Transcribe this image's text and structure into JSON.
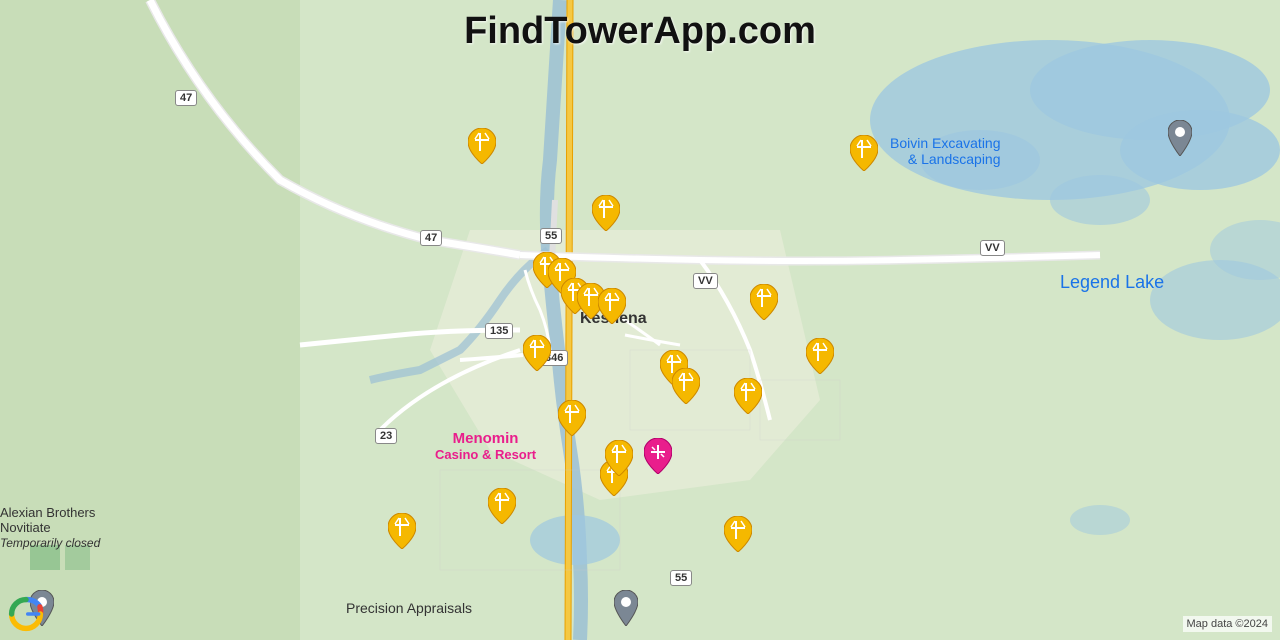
{
  "page": {
    "title": "FindTowerApp.com",
    "google_attribution": "Google",
    "map_attribution": "Map data ©2024"
  },
  "labels": {
    "legend_lake": "Legend Lake",
    "keshena": "Keshena",
    "boivin": "Boivin Excavating\n& Landscaping",
    "menomin_casino": "Menomin\nCasino & Resort",
    "alexian": "Alexian Brothers\nNovitiate\nTemporarily closed",
    "precision": "Precision Appraisals"
  },
  "roads": {
    "r47a": "47",
    "r47b": "47",
    "r55a": "55",
    "r55b": "55",
    "r135": "135",
    "r346": "346",
    "r23": "23",
    "vva": "VV",
    "vvb": "VV"
  },
  "colors": {
    "map_green": "#c8dbc8",
    "water_blue": "#a8c8e8",
    "road_yellow": "#f5c842",
    "road_white": "#ffffff",
    "tower_pin": "#f5b800",
    "gray_pin": "#888888",
    "pink_pin": "#e91e8c",
    "title_color": "#111111"
  }
}
